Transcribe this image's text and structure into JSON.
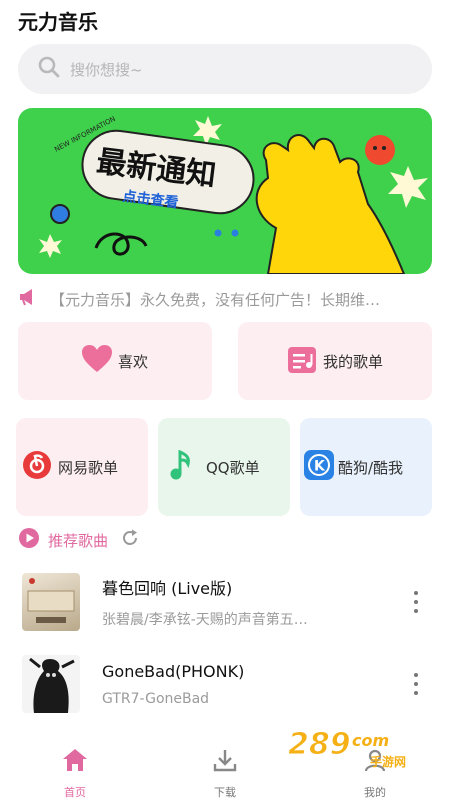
{
  "app": {
    "title": "元力音乐"
  },
  "search": {
    "placeholder": "搜你想搜~"
  },
  "banner": {
    "headline": "最新通知",
    "subline": "点击查看",
    "badge": "NEW INFORMATION"
  },
  "notice": {
    "text": "【元力音乐】永久免费，没有任何广告！长期维…"
  },
  "cards": {
    "likes": "喜欢",
    "my_playlists": "我的歌单"
  },
  "platforms": {
    "netease": "网易歌单",
    "qq": "QQ歌单",
    "kugou": "酷狗/酷我"
  },
  "section": {
    "title": "推荐歌曲"
  },
  "songs": [
    {
      "name": "暮色回响 (Live版)",
      "artist": "张碧晨/李承铉-天赐的声音第五…"
    },
    {
      "name": "GoneBad(PHONK)",
      "artist": "GTR7-GoneBad"
    }
  ],
  "tabs": [
    {
      "label": "首页"
    },
    {
      "label": "下载"
    },
    {
      "label": "我的"
    }
  ],
  "watermark": {
    "text": "289",
    "suffix": "com",
    "sub": "手游网"
  },
  "colors": {
    "accent": "#e06aa0",
    "banner_green": "#3fd14b",
    "banner_yellow": "#ffd60a",
    "netease_red": "#e83a3a",
    "qq_green": "#31c27c",
    "kugou_blue": "#2a82e4"
  }
}
